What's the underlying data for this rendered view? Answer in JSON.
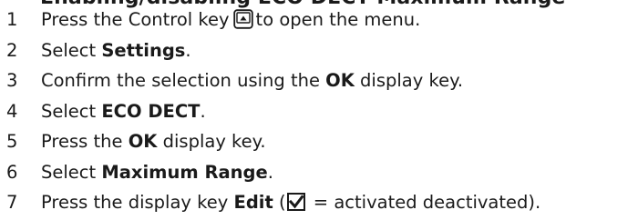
{
  "heading_fragment": "Enabling/disabling ECO DECT Maximum Range",
  "steps": [
    {
      "num": "1",
      "pre": "Press the Control key",
      "post": "to open the menu."
    },
    {
      "num": "2",
      "pre": "Select ",
      "bold": "Settings",
      "post": "."
    },
    {
      "num": "3",
      "pre": "Confirm the selection using the ",
      "bold": "OK",
      "post": " display key."
    },
    {
      "num": "4",
      "pre": "Select ",
      "bold": "ECO DECT",
      "post": "."
    },
    {
      "num": "5",
      "pre": "Press the ",
      "bold": "OK",
      "post": " display key."
    },
    {
      "num": "6",
      "pre": "Select ",
      "bold": "Maximum Range",
      "post": "."
    },
    {
      "num": "7",
      "pre": "Press the display key ",
      "bold": "Edit",
      "post_a": " (",
      "post_b": " = activated deactivated)."
    }
  ],
  "icons": {
    "control_key": "control-key-icon",
    "checkbox": "checked-checkbox-icon"
  }
}
